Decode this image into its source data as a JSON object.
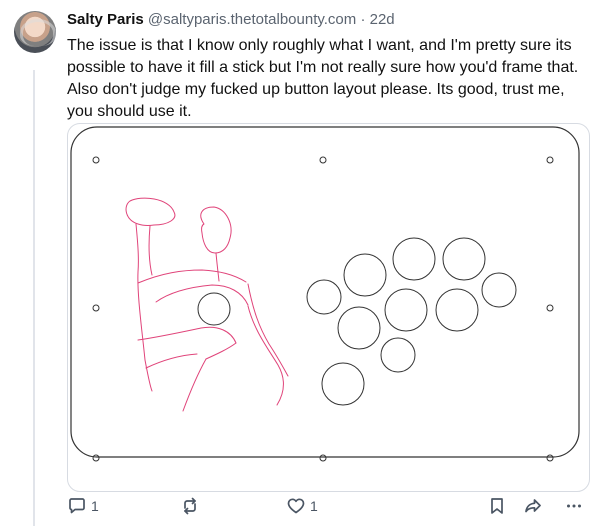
{
  "post": {
    "display_name": "Salty Paris",
    "handle": "@saltyparis.thetotalbounty.com",
    "separator": "·",
    "age": "22d",
    "text": "The issue is that I know only roughly what I want, and I'm pretty sure its possible to have it fill a stick but I'm not really sure how you'd frame that. Also don't judge my fucked up button layout please. Its good, trust me, you should use it."
  },
  "actions": {
    "reply_count": "1",
    "like_count": "1"
  },
  "colors": {
    "sketch": "#e0447a",
    "outline": "#333333",
    "muted": "#5b6470"
  },
  "icons": [
    "avatar",
    "reply-icon",
    "repost-icon",
    "like-icon",
    "bookmark-icon",
    "share-icon",
    "more-icon"
  ]
}
